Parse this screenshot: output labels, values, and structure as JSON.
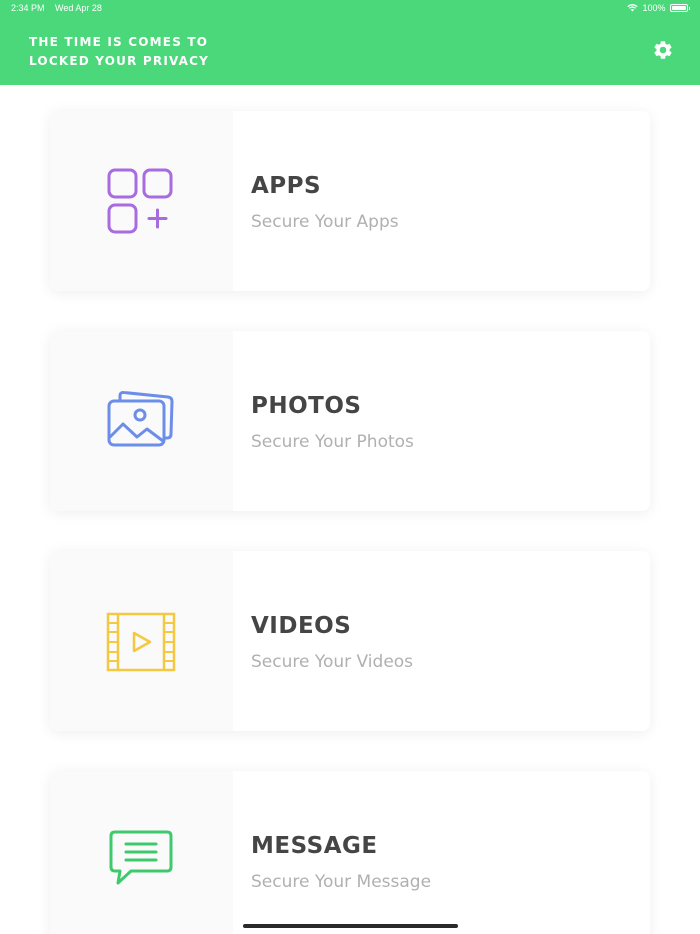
{
  "status_bar": {
    "time": "2:34 PM",
    "date": "Wed Apr 28",
    "battery": "100%"
  },
  "header": {
    "title_line1": "THE TIME IS COMES TO",
    "title_line2": "LOCKED YOUR PRIVACY",
    "background": "#4ad87a"
  },
  "cards": [
    {
      "title": "APPS",
      "subtitle": "Secure Your Apps",
      "icon": "apps-grid-icon",
      "color": "#a86be0"
    },
    {
      "title": "PHOTOS",
      "subtitle": "Secure Your Photos",
      "icon": "photos-icon",
      "color": "#6d8ee8"
    },
    {
      "title": "VIDEOS",
      "subtitle": "Secure Your Videos",
      "icon": "video-film-icon",
      "color": "#f5c842"
    },
    {
      "title": "MESSAGE",
      "subtitle": "Secure Your Message",
      "icon": "message-bubble-icon",
      "color": "#3ec96d"
    }
  ]
}
